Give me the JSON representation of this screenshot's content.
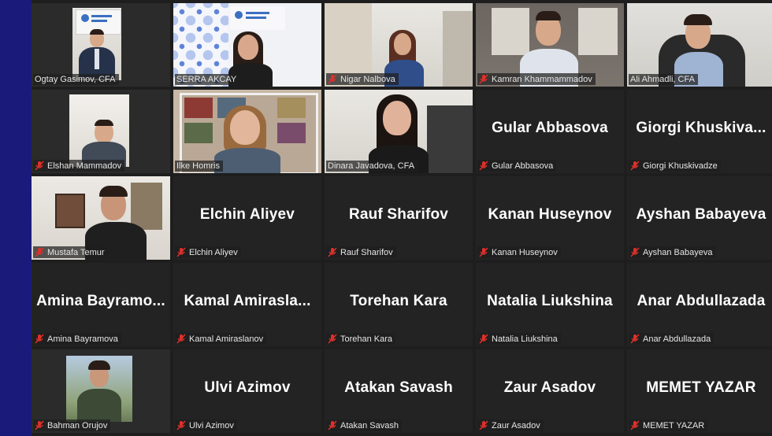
{
  "meeting": {
    "participants": [
      {
        "label": "Ogtay Gasimov, CFA",
        "big_name": "",
        "video": true,
        "muted": false
      },
      {
        "label": "SERRA AKCAY",
        "big_name": "",
        "video": true,
        "muted": false,
        "active_speaker": true
      },
      {
        "label": "Nigar Nalbova",
        "big_name": "",
        "video": true,
        "muted": true
      },
      {
        "label": "Kamran Khammammadov",
        "big_name": "",
        "video": true,
        "muted": true
      },
      {
        "label": "Ali Ahmadli, CFA",
        "big_name": "",
        "video": true,
        "muted": false
      },
      {
        "label": "Elshan Mammadov",
        "big_name": "",
        "video": true,
        "muted": true
      },
      {
        "label": "Ilke Homris",
        "big_name": "",
        "video": true,
        "muted": false
      },
      {
        "label": "Dinara Javadova, CFA",
        "big_name": "",
        "video": true,
        "muted": false
      },
      {
        "label": "Gular Abbasova",
        "big_name": "Gular Abbasova",
        "video": false,
        "muted": true
      },
      {
        "label": "Giorgi Khuskivadze",
        "big_name": "Giorgi  Khuskiva...",
        "video": false,
        "muted": true
      },
      {
        "label": "Mustafa Temur",
        "big_name": "",
        "video": true,
        "muted": true
      },
      {
        "label": "Elchin Aliyev",
        "big_name": "Elchin Aliyev",
        "video": false,
        "muted": true
      },
      {
        "label": "Rauf Sharifov",
        "big_name": "Rauf Sharifov",
        "video": false,
        "muted": true
      },
      {
        "label": "Kanan Huseynov",
        "big_name": "Kanan Huseynov",
        "video": false,
        "muted": true
      },
      {
        "label": "Ayshan Babayeva",
        "big_name": "Ayshan Babayeva",
        "video": false,
        "muted": true
      },
      {
        "label": "Amina Bayramova",
        "big_name": "Amina  Bayramo...",
        "video": false,
        "muted": true
      },
      {
        "label": "Kamal Amiraslanov",
        "big_name": "Kamal  Amirasla...",
        "video": false,
        "muted": true
      },
      {
        "label": "Torehan Kara",
        "big_name": "Torehan Kara",
        "video": false,
        "muted": true
      },
      {
        "label": "Natalia Liukshina",
        "big_name": "Natalia Liukshina",
        "video": false,
        "muted": true
      },
      {
        "label": "Anar Abdullazada",
        "big_name": "Anar Abdullazada",
        "video": false,
        "muted": true
      },
      {
        "label": "Bahman Orujov",
        "big_name": "",
        "video": true,
        "muted": true
      },
      {
        "label": "Ulvi Azimov",
        "big_name": "Ulvi Azimov",
        "video": false,
        "muted": true
      },
      {
        "label": "Atakan Savash",
        "big_name": "Atakan Savash",
        "video": false,
        "muted": true
      },
      {
        "label": "Zaur Asadov",
        "big_name": "Zaur Asadov",
        "video": false,
        "muted": true
      },
      {
        "label": "MEMET YAZAR",
        "big_name": "MEMET YAZAR",
        "video": false,
        "muted": true
      }
    ]
  },
  "colors": {
    "slide_background": "#1a1a7a",
    "tile_background": "#232323",
    "active_speaker_border": "#d7d32e",
    "muted_icon": "#e0302a"
  },
  "icons": {
    "muted": "mic-muted-icon"
  }
}
